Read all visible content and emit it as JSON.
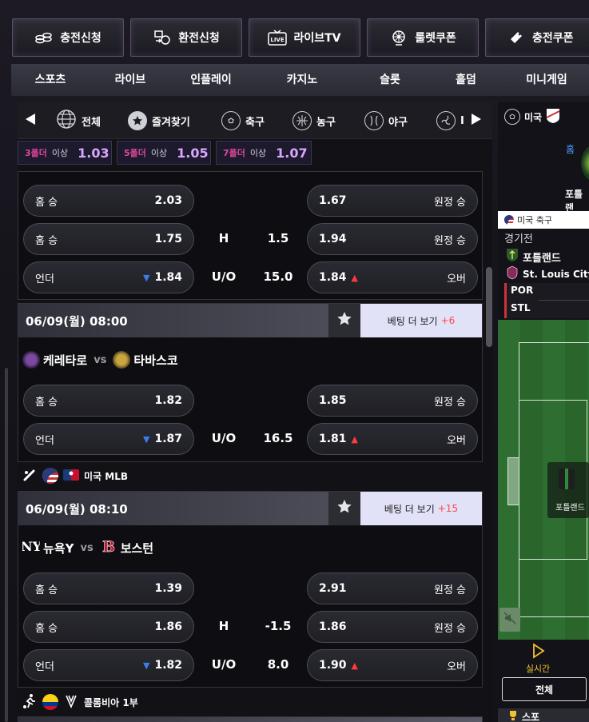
{
  "topbar": [
    {
      "label": "충전신청",
      "icon": "coins-icon"
    },
    {
      "label": "환전신청",
      "icon": "exchange-icon"
    },
    {
      "label": "라이브TV",
      "icon": "live-tv-icon"
    },
    {
      "label": "룰렛쿠폰",
      "icon": "roulette-icon"
    },
    {
      "label": "충전쿠폰",
      "icon": "coupon-icon"
    }
  ],
  "nav": [
    "스포츠",
    "라이브",
    "인플레이",
    "카지노",
    "슬롯",
    "홀덤",
    "미니게임"
  ],
  "sports": [
    "전체",
    "즐겨찾기",
    "축구",
    "농구",
    "야구",
    "I"
  ],
  "bonus": [
    {
      "folds": "3폴더",
      "suffix": "이상",
      "value": "1.03"
    },
    {
      "folds": "5폴더",
      "suffix": "이상",
      "value": "1.05"
    },
    {
      "folds": "7폴더",
      "suffix": "이상",
      "value": "1.07"
    }
  ],
  "labels": {
    "more": "베팅 더 보기",
    "home_win": "홈 승",
    "away_win": "원정 승",
    "under": "언더",
    "over": "오버",
    "vs": "vs",
    "handicap": "H",
    "uo": "U/O"
  },
  "card0": {
    "row1": {
      "home": "2.03",
      "away": "1.67"
    },
    "row2": {
      "home": "1.75",
      "line": "1.5",
      "away": "1.94"
    },
    "row3": {
      "home": "1.84",
      "line": "15.0",
      "away": "1.84"
    }
  },
  "card1": {
    "datetime": "06/09(월) 08:00",
    "more_count": "+6",
    "home_team": "케레타로",
    "away_team": "타바스코",
    "row1": {
      "home": "1.82",
      "away": "1.85"
    },
    "row3": {
      "home": "1.87",
      "line": "16.5",
      "away": "1.81"
    }
  },
  "league1": {
    "name": "미국 MLB"
  },
  "card2": {
    "datetime": "06/09(월) 08:10",
    "more_count": "+15",
    "home_team": "뉴욕Y",
    "away_team": "보스턴",
    "row1": {
      "home": "1.39",
      "away": "2.91"
    },
    "row2": {
      "home": "1.86",
      "line": "-1.5",
      "away": "1.86"
    },
    "row3": {
      "home": "1.82",
      "line": "8.0",
      "away": "1.90"
    }
  },
  "league2": {
    "name": "콜롬비아 1부"
  },
  "right": {
    "league_label": "미국",
    "home_short": "홈",
    "team_short": "포틀랜",
    "league_tag": "미국 축구",
    "match_label": "경기전",
    "team1": "포틀랜드",
    "team2": "St. Louis City",
    "abbr1": "POR",
    "abbr2": "STL",
    "player_label": "포틀랜드",
    "live_label": "실시간",
    "all_label": "전체",
    "bottom_label": "스포"
  }
}
